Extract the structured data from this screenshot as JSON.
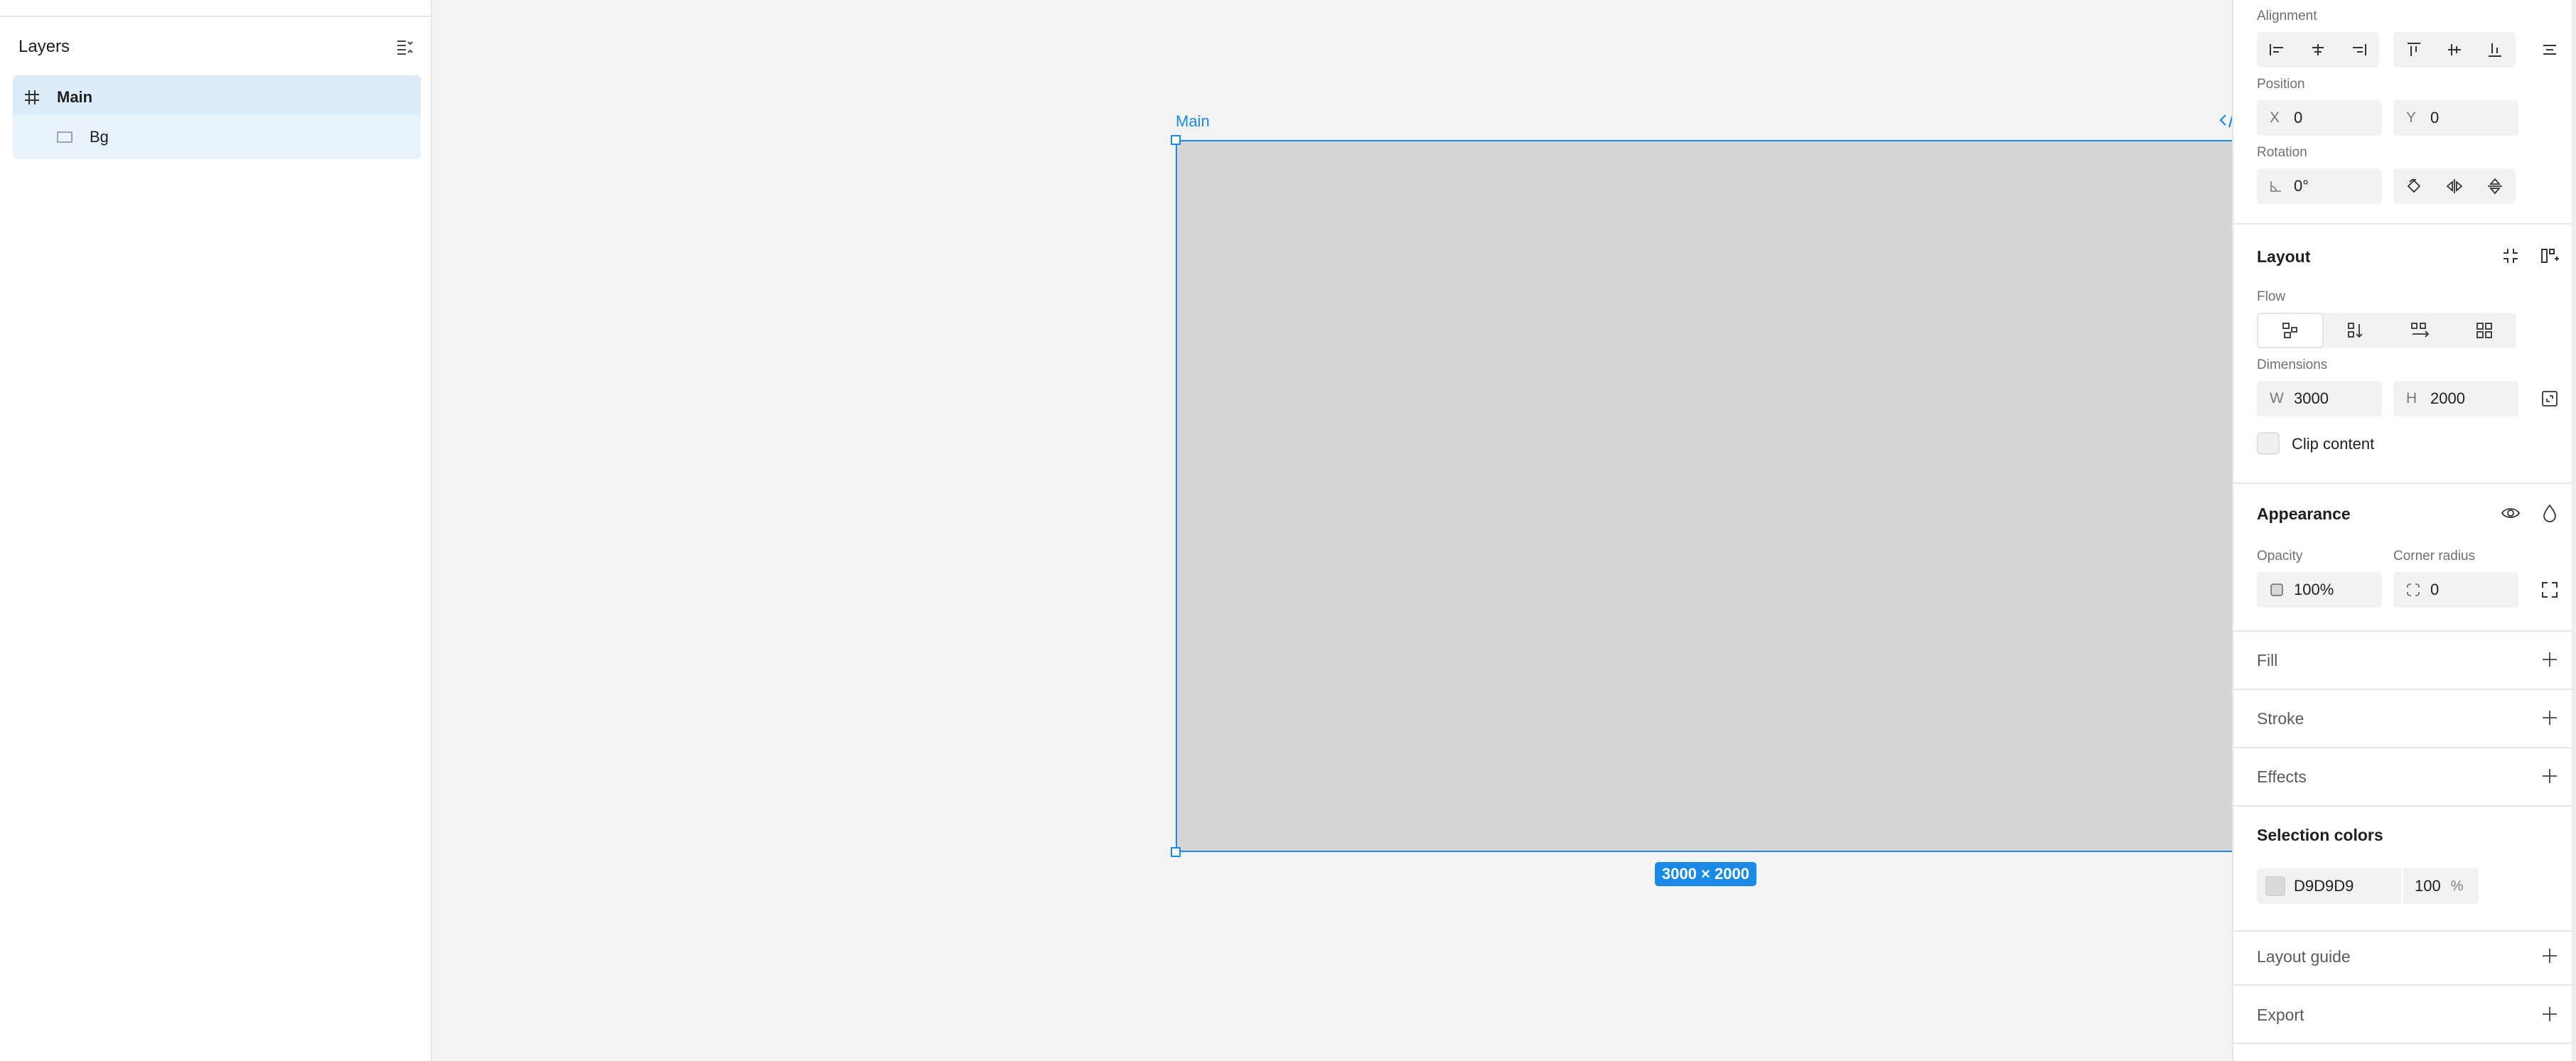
{
  "layers_panel": {
    "title": "Layers",
    "items": [
      {
        "label": "Main",
        "icon": "frame-hash-icon"
      },
      {
        "label": "Bg",
        "icon": "rectangle-icon"
      }
    ]
  },
  "canvas": {
    "frame_label": "Main",
    "size_badge": "3000 × 2000"
  },
  "properties": {
    "alignment": {
      "label": "Alignment"
    },
    "position": {
      "label": "Position",
      "x_prefix": "X",
      "x_value": "0",
      "y_prefix": "Y",
      "y_value": "0"
    },
    "rotation": {
      "label": "Rotation",
      "value": "0°"
    },
    "layout": {
      "title": "Layout",
      "flow_label": "Flow",
      "dimensions_label": "Dimensions",
      "w_prefix": "W",
      "w_value": "3000",
      "h_prefix": "H",
      "h_value": "2000",
      "clip_label": "Clip content"
    },
    "appearance": {
      "title": "Appearance",
      "opacity_label": "Opacity",
      "opacity_value": "100%",
      "radius_label": "Corner radius",
      "radius_value": "0"
    },
    "fill": {
      "title": "Fill"
    },
    "stroke": {
      "title": "Stroke"
    },
    "effects": {
      "title": "Effects"
    },
    "selection_colors": {
      "title": "Selection colors",
      "hex": "D9D9D9",
      "swatch": "#d9d9d9",
      "opacity": "100",
      "unit": "%"
    },
    "layout_guide": {
      "title": "Layout guide"
    },
    "export": {
      "title": "Export"
    }
  },
  "colors": {
    "accent": "#1a8ae6",
    "frame_fill": "#d6d6d6"
  }
}
